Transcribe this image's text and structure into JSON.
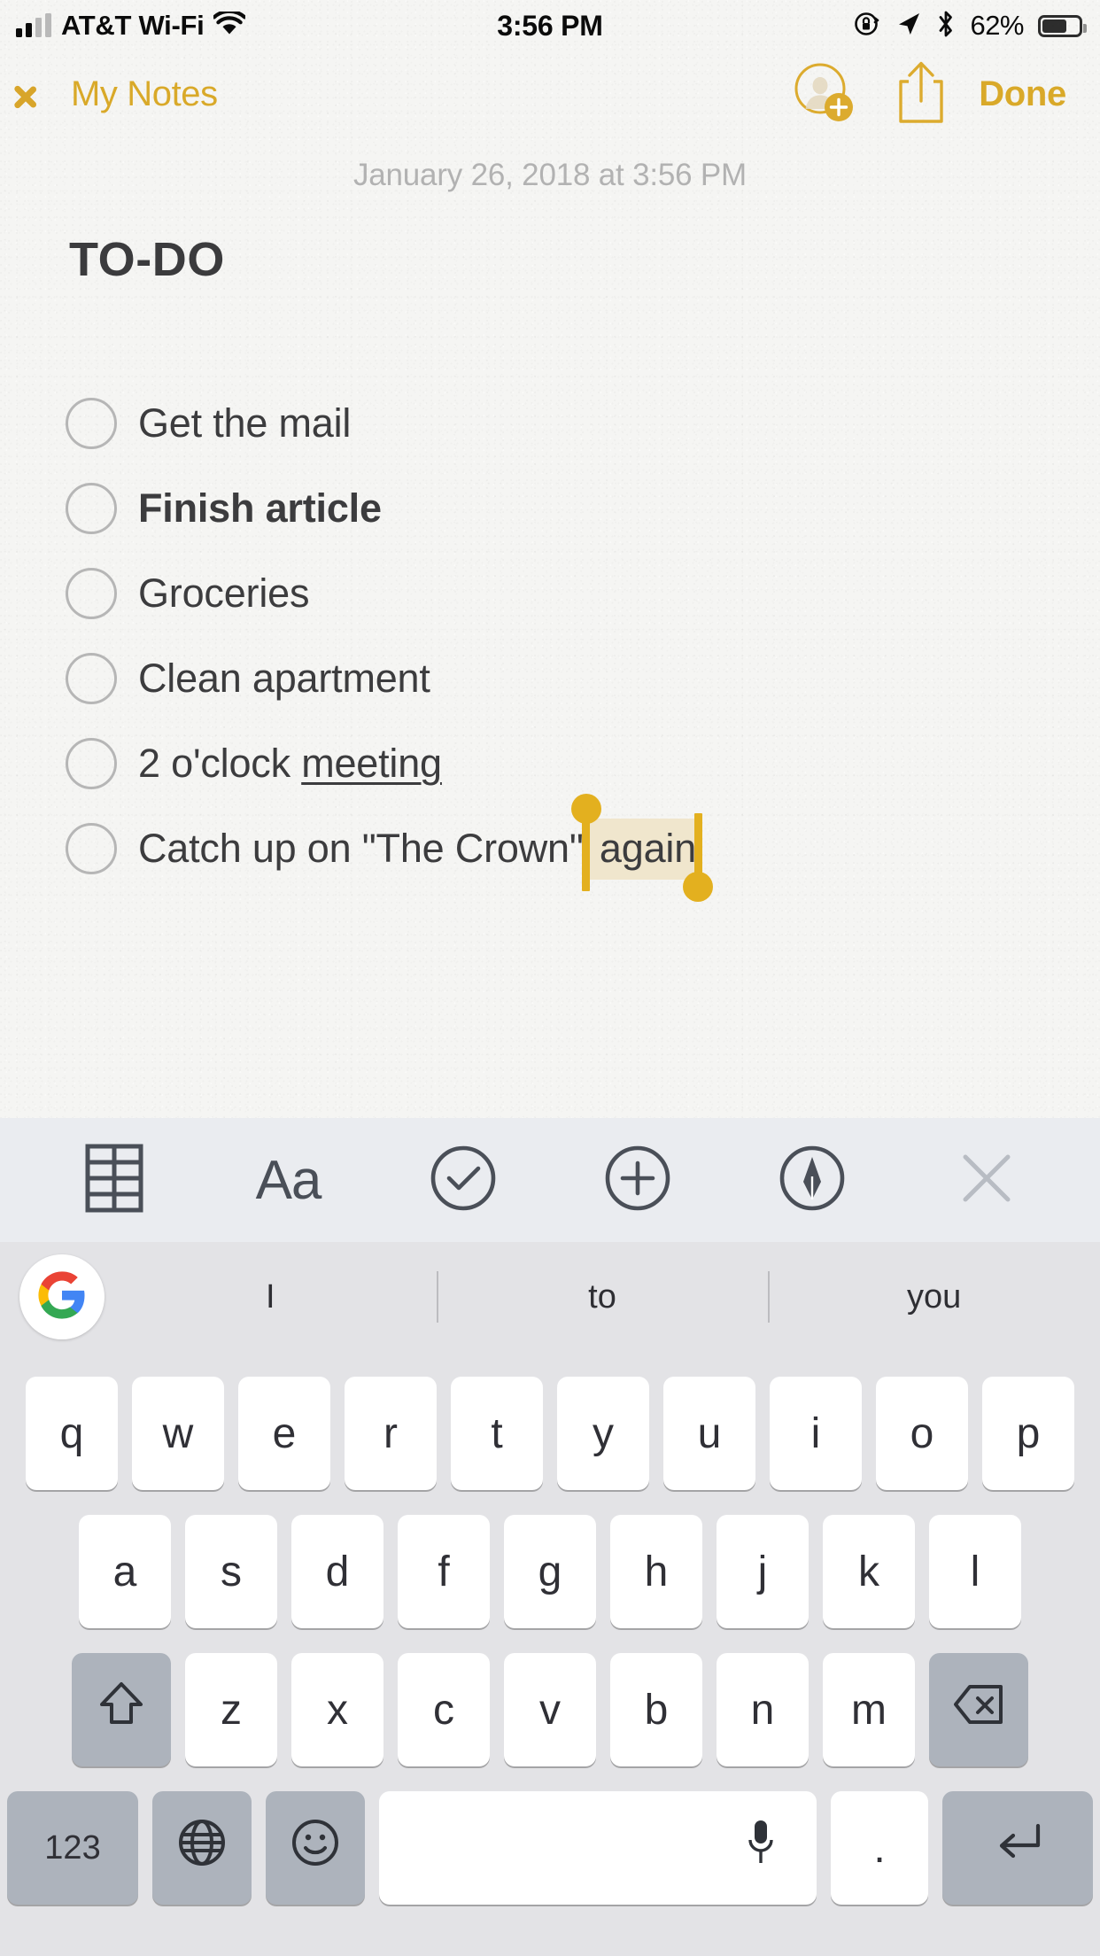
{
  "status_bar": {
    "carrier": "AT&T Wi-Fi",
    "wifi_icon": "wifi-icon",
    "signal_icon": "cellular-signal-icon",
    "time": "3:56 PM",
    "rotation_lock_icon": "rotation-lock-icon",
    "location_icon": "location-arrow-icon",
    "bluetooth_icon": "bluetooth-icon",
    "battery_percent": "62%",
    "battery_icon": "battery-icon"
  },
  "nav_bar": {
    "back_label": "My Notes",
    "back_chevron_icon": "chevron-left-icon",
    "add_person_icon": "add-person-icon",
    "share_icon": "share-icon",
    "done_label": "Done"
  },
  "note": {
    "date": "January 26, 2018 at 3:56 PM",
    "title": "TO-DO",
    "items": [
      {
        "text": "Get the mail",
        "bold": false,
        "underline_part": ""
      },
      {
        "text": "Finish article",
        "bold": true,
        "underline_part": ""
      },
      {
        "text": "Groceries",
        "bold": false,
        "underline_part": ""
      },
      {
        "text": "Clean apartment",
        "bold": false,
        "underline_part": ""
      },
      {
        "text": "2 o'clock meeting",
        "bold": false,
        "underline_part": "meeting",
        "prefix": "2 o'clock "
      },
      {
        "text": "Catch up on \"The Crown\" again",
        "bold": false,
        "prefix": "Catch up on \"The Crown\"",
        "selected": " again"
      }
    ]
  },
  "selection": {
    "selected_text": " again",
    "highlight_color": "#f0e6cd",
    "handle_color": "#e3b01f"
  },
  "format_toolbar": {
    "buttons": [
      {
        "name": "table-icon",
        "label": ""
      },
      {
        "name": "text-format-icon",
        "label": "Aa"
      },
      {
        "name": "checklist-icon",
        "label": ""
      },
      {
        "name": "add-attachment-icon",
        "label": ""
      },
      {
        "name": "markup-pen-icon",
        "label": ""
      },
      {
        "name": "close-icon",
        "label": ""
      }
    ]
  },
  "suggestions": {
    "google_icon": "google-logo-icon",
    "words": [
      "I",
      "to",
      "you"
    ]
  },
  "keyboard": {
    "row1": [
      "q",
      "w",
      "e",
      "r",
      "t",
      "y",
      "u",
      "i",
      "o",
      "p"
    ],
    "row2": [
      "a",
      "s",
      "d",
      "f",
      "g",
      "h",
      "j",
      "k",
      "l"
    ],
    "row3": [
      "z",
      "x",
      "c",
      "v",
      "b",
      "n",
      "m"
    ],
    "shift_icon": "shift-icon",
    "backspace_icon": "backspace-icon",
    "numbers_label": "123",
    "globe_icon": "globe-icon",
    "emoji_icon": "emoji-icon",
    "space_label": "",
    "mic_icon": "microphone-icon",
    "period_label": ".",
    "return_icon": "return-icon"
  },
  "colors": {
    "accent_gold": "#d9a929",
    "note_paper": "#f5f5f3",
    "toolbar_bg": "#eaecf0",
    "keyboard_bg": "#e3e3e6",
    "key_white": "#ffffff",
    "key_gray": "#adb3bc",
    "text_dark": "#3c3c3e",
    "date_gray": "#b2b2b2"
  }
}
